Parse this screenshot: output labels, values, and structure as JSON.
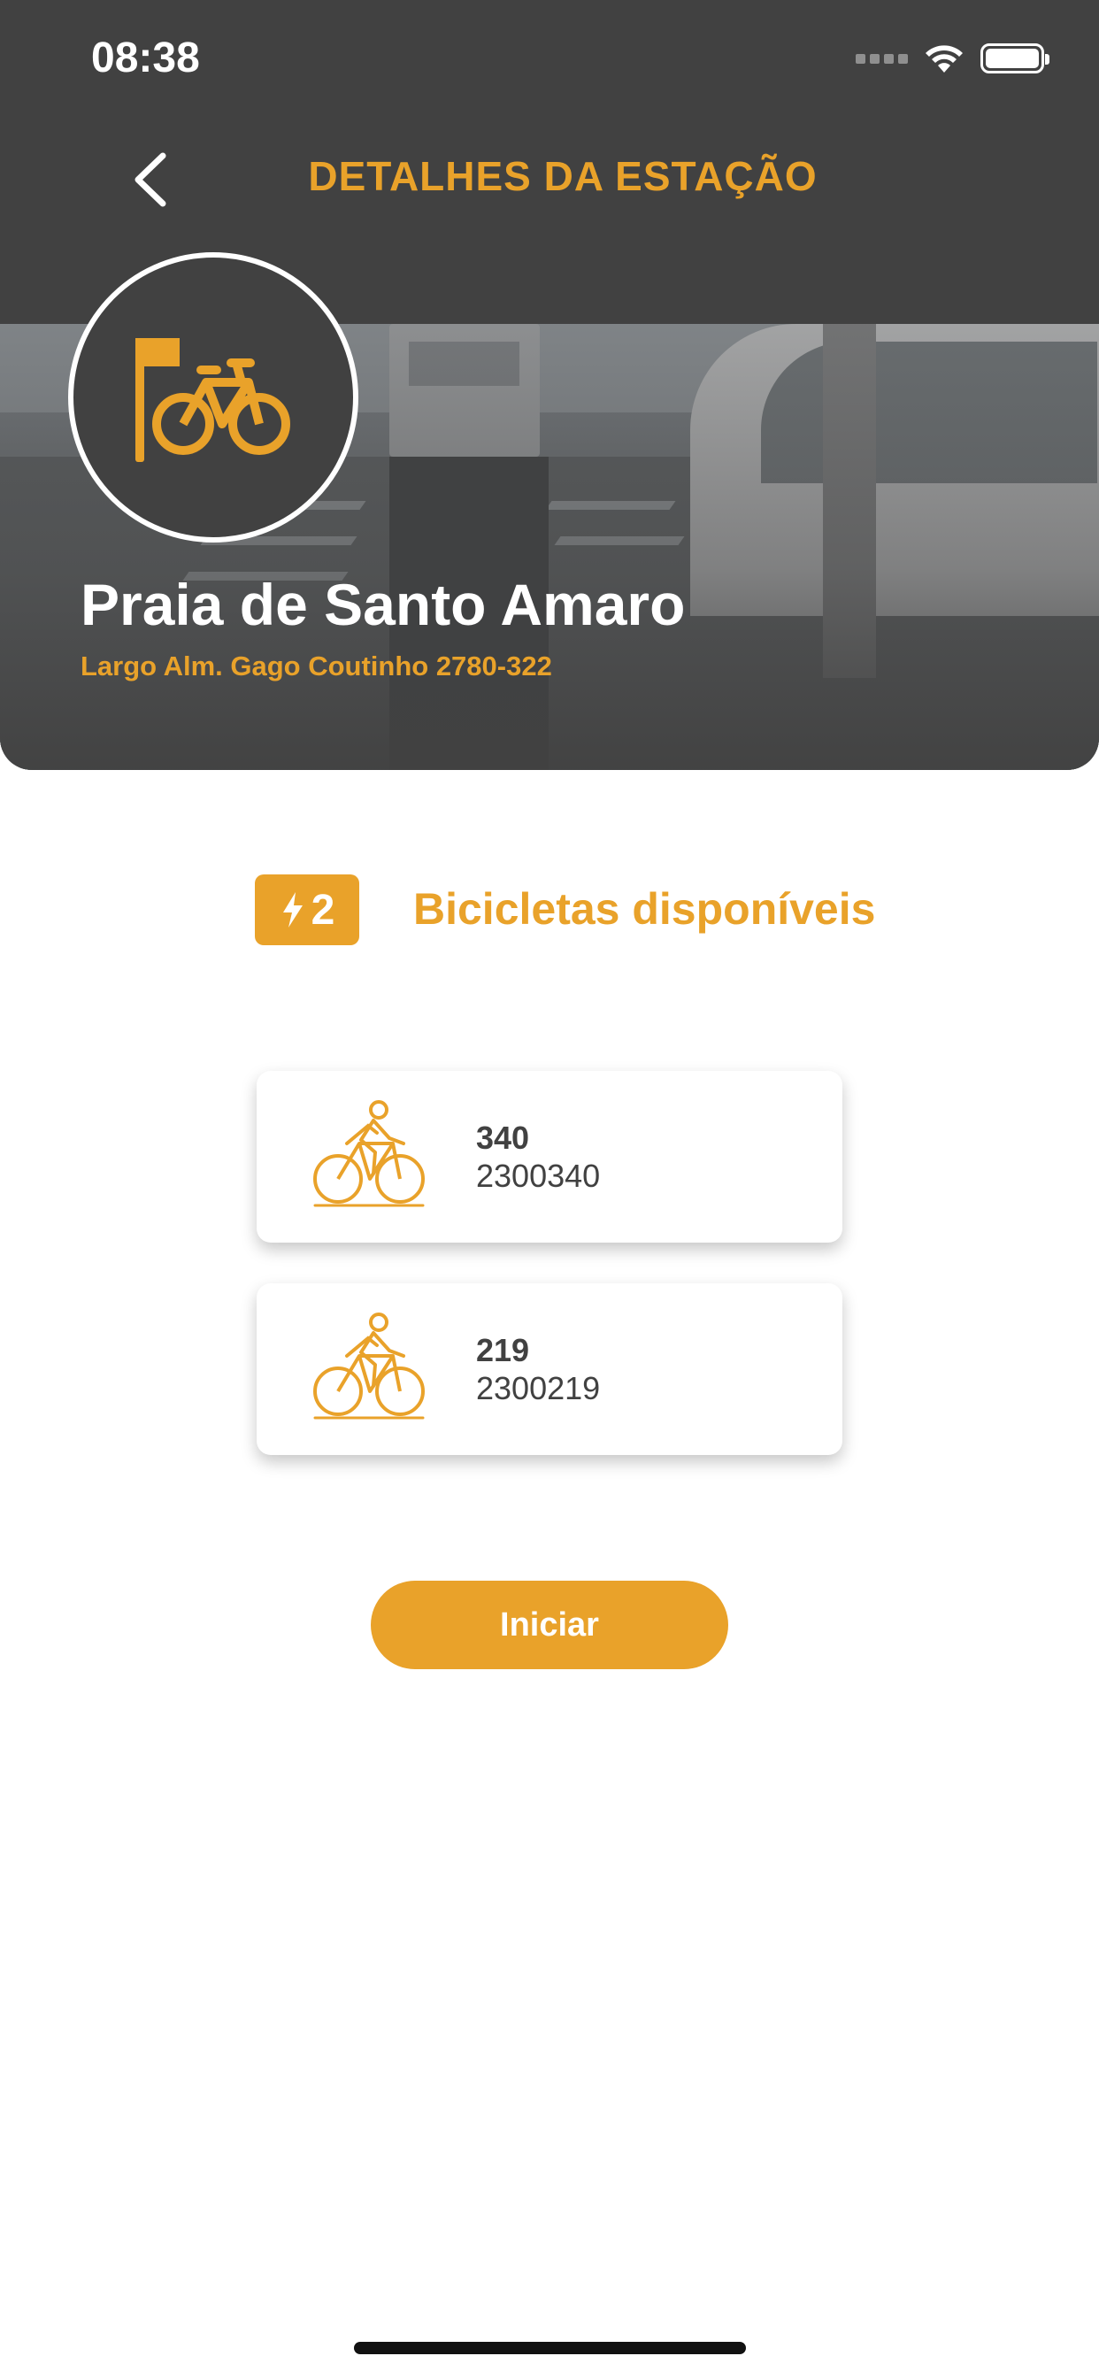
{
  "status_bar": {
    "time": "08:38"
  },
  "header": {
    "title": "DETALHES DA ESTAÇÃO"
  },
  "station": {
    "name": "Praia de Santo Amaro",
    "address": "Largo Alm. Gago Coutinho 2780-322",
    "icon": "bike-station-icon"
  },
  "availability": {
    "count": "2",
    "label": "Bicicletas disponíveis",
    "icon": "lightning-icon"
  },
  "bikes": [
    {
      "id": "340",
      "serial": "2300340",
      "icon": "cyclist-icon"
    },
    {
      "id": "219",
      "serial": "2300219",
      "icon": "cyclist-icon"
    }
  ],
  "actions": {
    "start_label": "Iniciar"
  },
  "colors": {
    "accent": "#e9a22a",
    "dark": "#414141",
    "background": "#ffffff"
  }
}
